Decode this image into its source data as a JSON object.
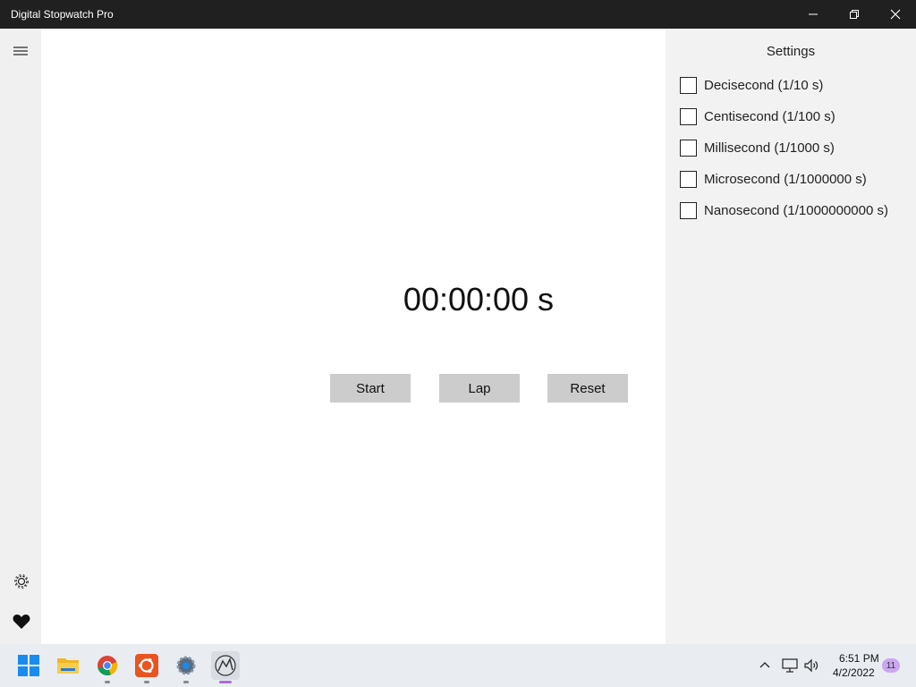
{
  "window": {
    "title": "Digital Stopwatch Pro"
  },
  "rail": {
    "icons": [
      "hamburger-menu-icon",
      "gear-icon",
      "heart-icon"
    ]
  },
  "stopwatch": {
    "time": "00:00:00 s",
    "start_label": "Start",
    "lap_label": "Lap",
    "reset_label": "Reset"
  },
  "settings": {
    "heading": "Settings",
    "options": [
      {
        "label": "Decisecond (1/10 s)",
        "checked": false
      },
      {
        "label": "Centisecond (1/100 s)",
        "checked": false
      },
      {
        "label": "Millisecond (1/1000 s)",
        "checked": false
      },
      {
        "label": "Microsecond (1/1000000 s)",
        "checked": false
      },
      {
        "label": "Nanosecond (1/1000000000 s)",
        "checked": false
      }
    ]
  },
  "taskbar": {
    "apps": [
      "start-icon",
      "file-explorer-icon",
      "chrome-icon",
      "ubuntu-icon",
      "settings-app-icon",
      "stopwatch-app-icon"
    ],
    "clock_time": "6:51 PM",
    "clock_date": "4/2/2022",
    "notification_count": "11"
  },
  "colors": {
    "titlebar": "#202020",
    "panel": "#f2f2f2",
    "button": "#cccccc",
    "taskbar": "#e9edf2"
  }
}
